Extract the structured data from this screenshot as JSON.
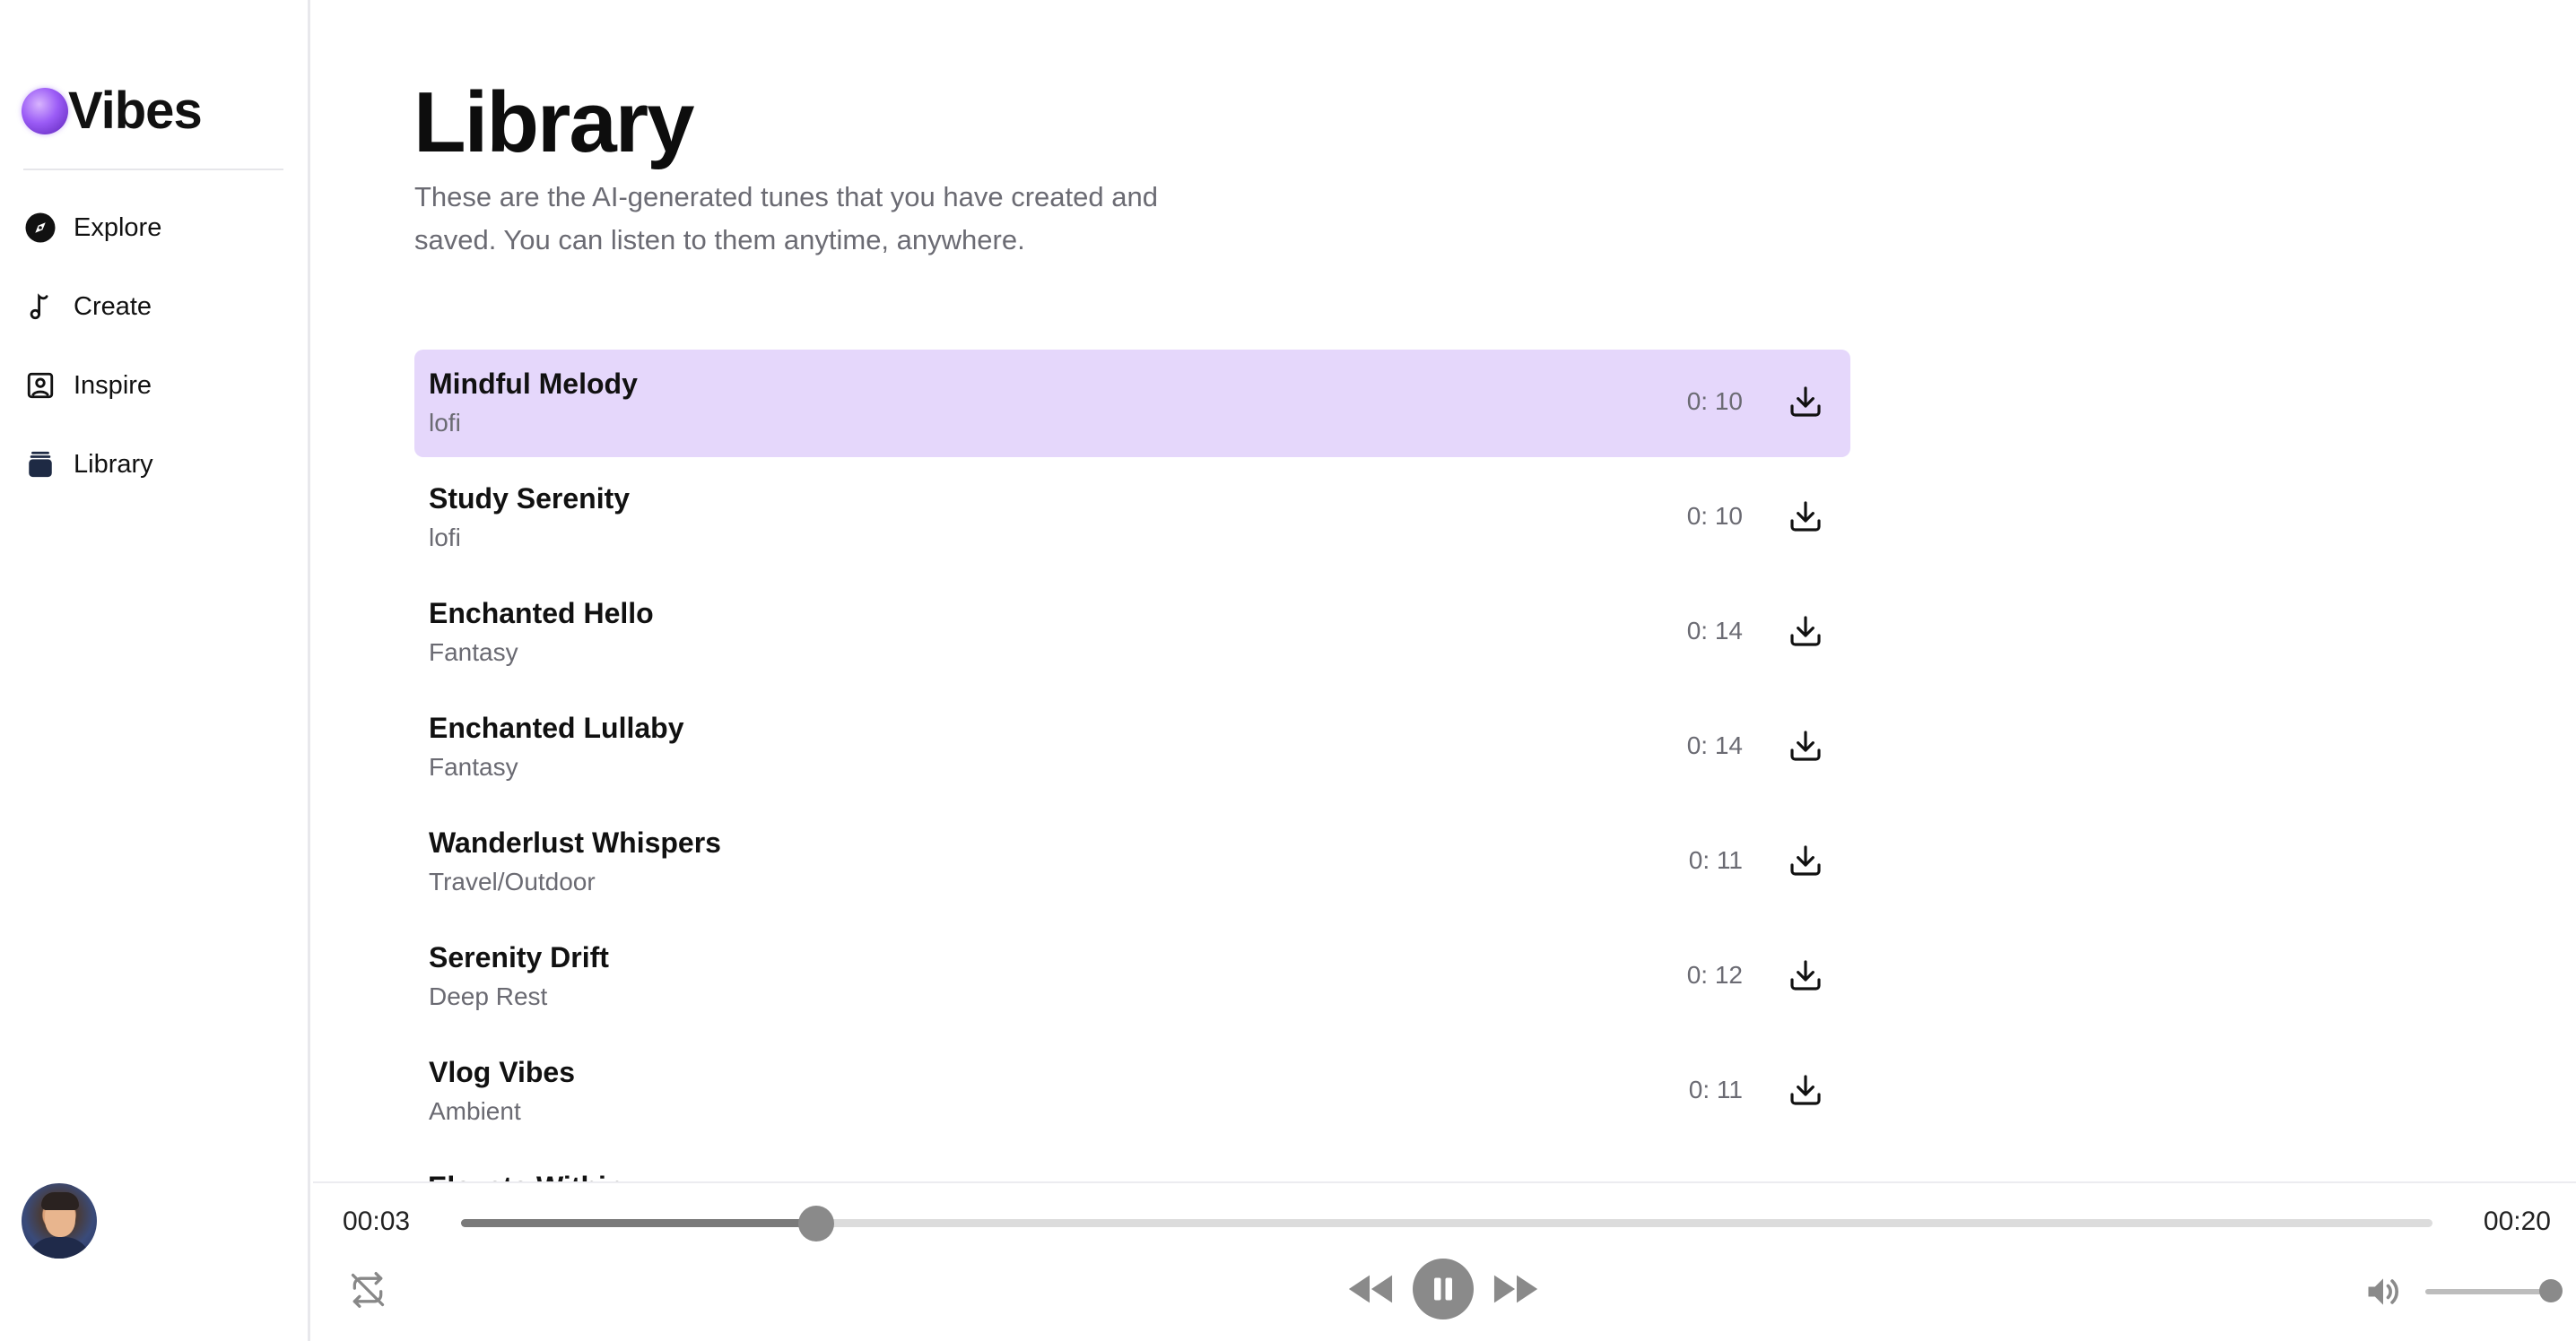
{
  "brand": {
    "name": "Vibes"
  },
  "nav": {
    "items": [
      {
        "label": "Explore",
        "icon": "compass-icon"
      },
      {
        "label": "Create",
        "icon": "music-note-icon"
      },
      {
        "label": "Inspire",
        "icon": "image-icon"
      },
      {
        "label": "Library",
        "icon": "library-icon"
      }
    ]
  },
  "page": {
    "title": "Library",
    "subtitle": "These are the AI-generated tunes that you have created and saved. You can listen to them anytime, anywhere."
  },
  "tracks": [
    {
      "title": "Mindful Melody",
      "genre": "lofi",
      "duration": "0: 10",
      "active": true
    },
    {
      "title": "Study Serenity",
      "genre": "lofi",
      "duration": "0: 10"
    },
    {
      "title": "Enchanted Hello",
      "genre": "Fantasy",
      "duration": "0: 14"
    },
    {
      "title": "Enchanted Lullaby",
      "genre": "Fantasy",
      "duration": "0: 14"
    },
    {
      "title": "Wanderlust Whispers",
      "genre": "Travel/Outdoor",
      "duration": "0: 11"
    },
    {
      "title": "Serenity Drift",
      "genre": "Deep Rest",
      "duration": "0: 12"
    },
    {
      "title": "Vlog Vibes",
      "genre": "Ambient",
      "duration": "0: 11"
    }
  ],
  "partial_track": {
    "title": "Elevate Within"
  },
  "player": {
    "current_time": "00:03",
    "total_time": "00:20",
    "progress_fraction": 0.18,
    "volume_fraction": 1.0,
    "state": "playing"
  },
  "colors": {
    "active_row": "#e5d7fb",
    "accent": "#8b5cf6",
    "control_gray": "#8a8a8a"
  }
}
